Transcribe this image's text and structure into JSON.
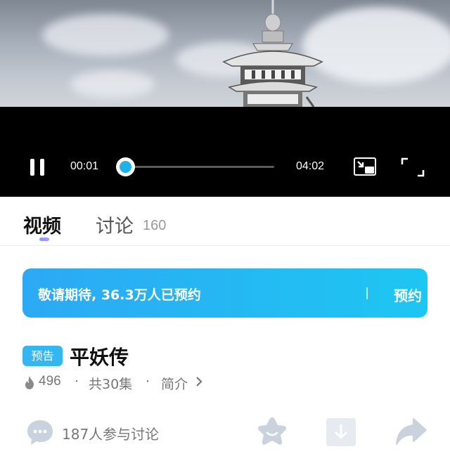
{
  "player": {
    "current_time": "00:01",
    "duration": "04:02",
    "progress": 0.004,
    "icons": [
      "pause-icon",
      "picture-in-picture-icon",
      "fullscreen-icon"
    ]
  },
  "tabs": [
    {
      "label": "视频",
      "active": true
    },
    {
      "label": "讨论",
      "count": "160",
      "active": false
    }
  ],
  "banner": {
    "text": "敬请期待, 36.3万人已预约",
    "button_label": "预约"
  },
  "show": {
    "badge": "预告",
    "title": "平妖传",
    "heat": "496",
    "separator": "·",
    "episodes": "共30集",
    "intro_label": "简介"
  },
  "actions": {
    "comment_text": "187人参与讨论",
    "icons": [
      "comment-icon",
      "star-icon",
      "download-icon",
      "share-icon"
    ]
  },
  "colors": {
    "accent": "#1fb2e6",
    "banner_start": "#2ca9f4",
    "banner_end": "#1ec6f2",
    "badge": "#35b6f1",
    "icon_gray": "#c9d2dd"
  }
}
